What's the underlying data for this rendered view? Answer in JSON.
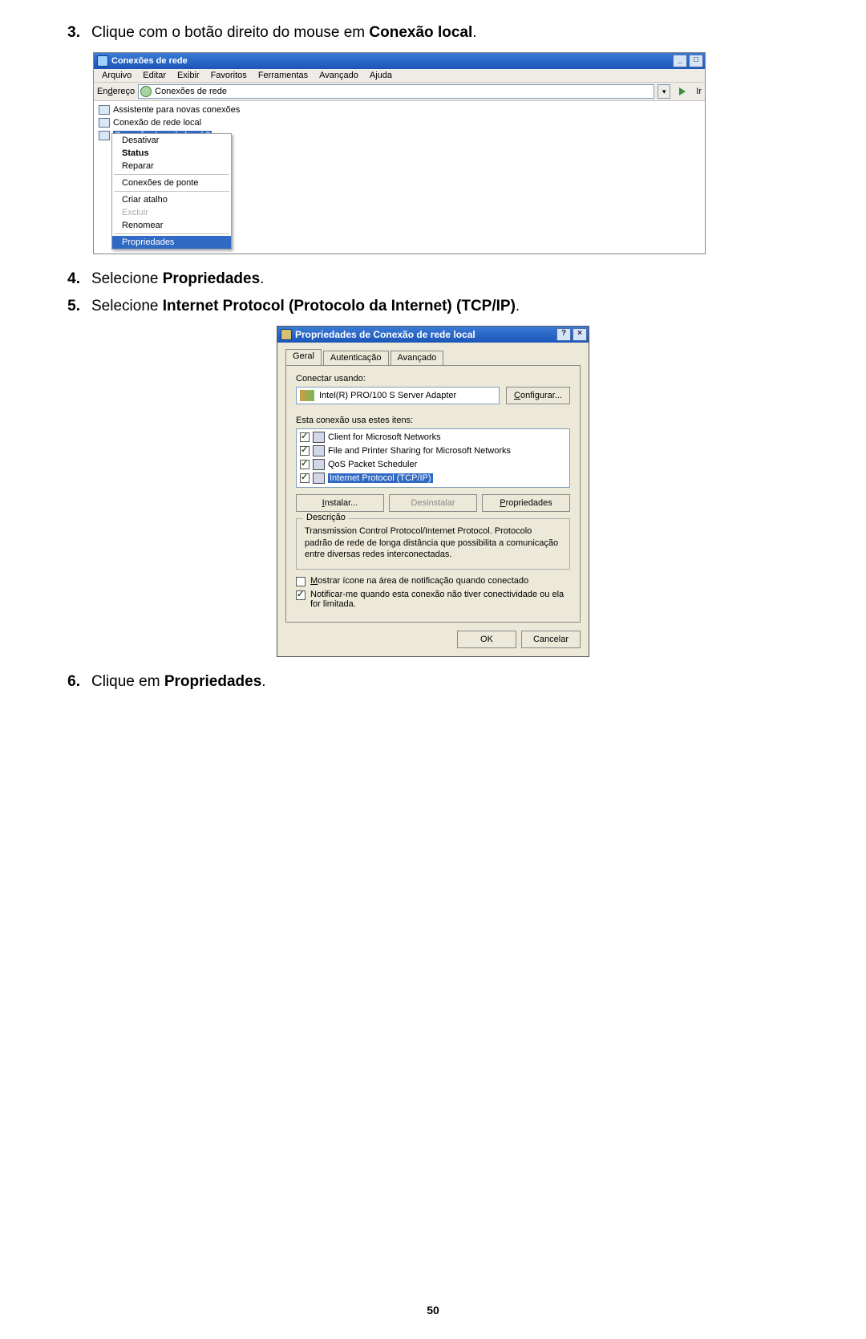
{
  "steps": {
    "s3_num": "3.",
    "s3_a": "Clique com o botão direito do mouse em ",
    "s3_b": "Conexão local",
    "s3_c": ".",
    "s4_num": "4.",
    "s4_a": "Selecione ",
    "s4_b": "Propriedades",
    "s4_c": ".",
    "s5_num": "5.",
    "s5_a": "Selecione ",
    "s5_b": "Internet Protocol (Protocolo da Internet) (TCP/IP)",
    "s5_c": ".",
    "s6_num": "6.",
    "s6_a": "Clique em ",
    "s6_b": "Propriedades",
    "s6_c": "."
  },
  "page_number": "50",
  "shot1": {
    "title": "Conexões de rede",
    "win_min": "_",
    "win_max": "□",
    "menus": {
      "arquivo": "Arquivo",
      "editar": "Editar",
      "exibir": "Exibir",
      "favoritos": "Favoritos",
      "ferramentas": "Ferramentas",
      "avancado": "Avançado",
      "ajuda": "Ajuda"
    },
    "address_label": "Endereço",
    "address_value": "Conexões de rede",
    "go_label": "Ir",
    "tree": {
      "item1": "Assistente para novas conexões",
      "item2": "Conexão de rede local",
      "item3": "Conexão de rede local 2"
    },
    "ctx": {
      "desativar": "Desativar",
      "status": "Status",
      "reparar": "Reparar",
      "ponte": "Conexões de ponte",
      "criar": "Criar atalho",
      "excluir": "Excluir",
      "renomear": "Renomear",
      "propriedades": "Propriedades"
    }
  },
  "shot2": {
    "title": "Propriedades de Conexão de rede local",
    "help_btn": "?",
    "close_btn": "×",
    "tabs": {
      "geral": "Geral",
      "autenticacao": "Autenticação",
      "avancado": "Avançado"
    },
    "connect_label": "Conectar usando:",
    "adapter": "Intel(R) PRO/100 S Server Adapter",
    "configure_btn": "Configurar...",
    "items_label": "Esta conexão usa estes itens:",
    "items": {
      "i1": "Client for Microsoft Networks",
      "i2": "File and Printer Sharing for Microsoft Networks",
      "i3": "QoS Packet Scheduler",
      "i4": "Internet Protocol (TCP/IP)"
    },
    "btns": {
      "instalar": "Instalar...",
      "desinstalar": "Desinstalar",
      "propriedades": "Propriedades"
    },
    "desc_legend": "Descrição",
    "desc_text": "Transmission Control Protocol/Internet Protocol. Protocolo padrão de rede de longa distância que possibilita a comunicação entre diversas redes interconectadas.",
    "chk1": "Mostrar ícone na área de notificação quando conectado",
    "chk2": "Notificar-me quando esta conexão não tiver conectividade ou ela for limitada.",
    "ok": "OK",
    "cancel": "Cancelar"
  }
}
